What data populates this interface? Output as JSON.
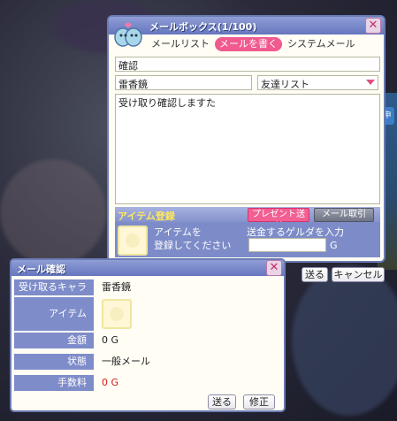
{
  "mailbox": {
    "title": "メールボックス(1/100)",
    "tabs": [
      "メールリスト",
      "メールを書く",
      "システムメール"
    ],
    "subject": "確認",
    "recipient": "雷香鏡",
    "friend_list": "友達リスト",
    "body": "受け取り確認しますた",
    "item_section_label": "アイテム登録",
    "present_button": "プレゼント送付",
    "mail_receive_button": "メール取引",
    "item_hint_line1": "アイテムを",
    "item_hint_line2": "登録してください",
    "zeny_label": "送金するゲルダを入力",
    "zeny_unit": "G",
    "send_button": "送る",
    "cancel_button": "キャンセル"
  },
  "confirm": {
    "title": "メール確認",
    "rows": [
      {
        "key": "受け取るキャラ",
        "value": "雷香鏡"
      },
      {
        "key": "アイテム",
        "value": ""
      },
      {
        "key": "金額",
        "value": "0 G"
      },
      {
        "key": "状態",
        "value": "一般メール"
      },
      {
        "key": "手数料",
        "value": "0 G"
      }
    ],
    "send_button": "送る",
    "edit_button": "修正"
  },
  "side_tab": "申",
  "colors": {
    "accent": "#6576be",
    "pink": "#f05a8e",
    "fee_red": "#d21a1a"
  }
}
